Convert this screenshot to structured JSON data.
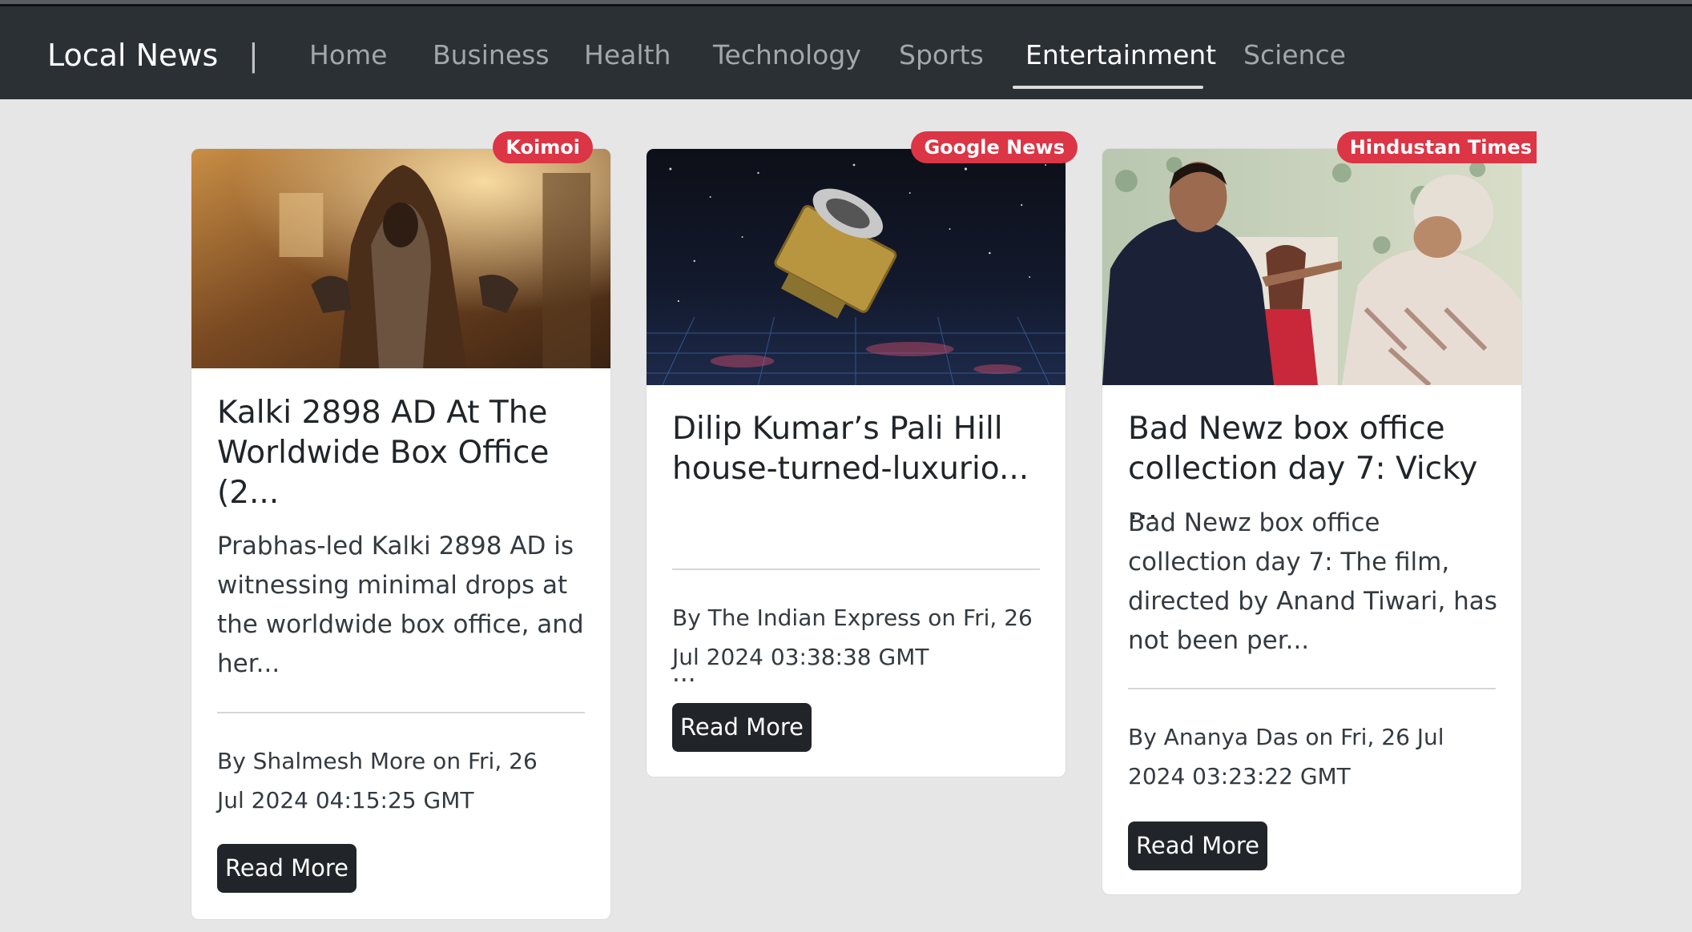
{
  "navbar": {
    "brand": "Local News",
    "separator": "|",
    "links": [
      {
        "label": "Home",
        "active": false
      },
      {
        "label": "Business",
        "active": false
      },
      {
        "label": "Health",
        "active": false
      },
      {
        "label": "Technology",
        "active": false
      },
      {
        "label": "Sports",
        "active": false
      },
      {
        "label": "Entertainment",
        "active": true
      },
      {
        "label": "Science",
        "active": false
      }
    ]
  },
  "articles": [
    {
      "source": "Koimoi",
      "title": "Kalki 2898 AD At The Worldwide Box Office (2...",
      "description": "Prabhas-led Kalki 2898 AD is witnessing minimal drops at the worldwide box office, and her...",
      "byline": "By Shalmesh More on Fri, 26 Jul 2024 04:15:25 GMT",
      "button_label": "Read More"
    },
    {
      "source": "Google News",
      "title": "Dilip Kumar’s Pali Hill house-turned-luxurio...",
      "description": "...",
      "byline": "By The Indian Express on Fri, 26 Jul 2024 03:38:38 GMT",
      "button_label": "Read More"
    },
    {
      "source": "Hindustan Times",
      "title": "Bad Newz box office collection day 7: Vicky ...",
      "description": "Bad Newz box office collection day 7: The film, directed by Anand Tiwari, has not been per...",
      "byline": "By Ananya Das on Fri, 26 Jul 2024 03:23:22 GMT",
      "button_label": "Read More"
    }
  ],
  "colors": {
    "navbar_bg": "#2b3035",
    "badge_bg": "#dc3545",
    "button_bg": "#212529",
    "page_bg": "#e6e6e6"
  }
}
